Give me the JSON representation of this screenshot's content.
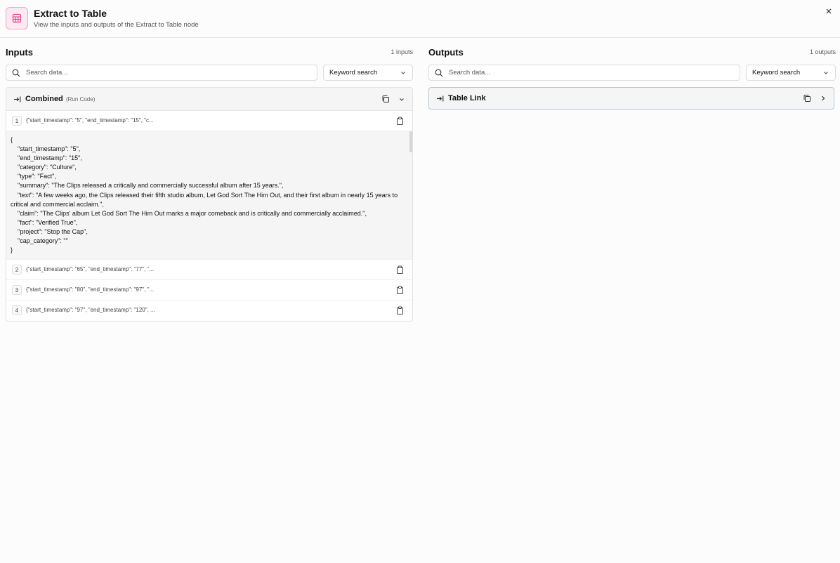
{
  "header": {
    "title": "Extract to Table",
    "subtitle": "View the inputs and outputs of the Extract to Table node",
    "icon": "table-icon",
    "accent_color": "#e0458a"
  },
  "inputs": {
    "title": "Inputs",
    "count": "1 inputs",
    "search_placeholder": "Search data...",
    "search_mode": "Keyword search",
    "card": {
      "title": "Combined",
      "subtitle": "(Run Code)",
      "rows": [
        {
          "index": "1",
          "preview": "{\"start_timestamp\": \"5\", \"end_timestamp\": \"15\", \"c..."
        },
        {
          "index": "2",
          "preview": "{\"start_timestamp\": \"65\", \"end_timestamp\": \"77\", \"..."
        },
        {
          "index": "3",
          "preview": "{\"start_timestamp\": \"80\", \"end_timestamp\": \"97\", \"..."
        },
        {
          "index": "4",
          "preview": "{\"start_timestamp\": \"97\", \"end_timestamp\": \"120\", ..."
        }
      ],
      "expanded_lines": {
        "open": "{",
        "l1": "\"start_timestamp\": \"5\",",
        "l2": "\"end_timestamp\": \"15\",",
        "l3": "\"category\": \"Culture\",",
        "l4": "\"type\": \"Fact\",",
        "l5": "\"summary\": \"The Clips released a critically and commercially successful album after 15 years.\",",
        "l6": "\"text\": \"A few weeks ago, the Clips released their fifth studio album, Let God Sort The Him Out, and their first album in nearly 15 years to critical and commercial acclaim.\",",
        "l7": "\"claim\": \"The Clips' album Let God Sort The Him Out marks a major comeback and is critically and commercially acclaimed.\",",
        "l8": "\"fact\": \"Verified True\",",
        "l9": "\"project\": \"Stop the Cap\",",
        "l10": "\"cap_category\": \"\"",
        "close": "}"
      }
    }
  },
  "outputs": {
    "title": "Outputs",
    "count": "1 outputs",
    "search_placeholder": "Search data...",
    "search_mode": "Keyword search",
    "card": {
      "title": "Table Link"
    }
  }
}
